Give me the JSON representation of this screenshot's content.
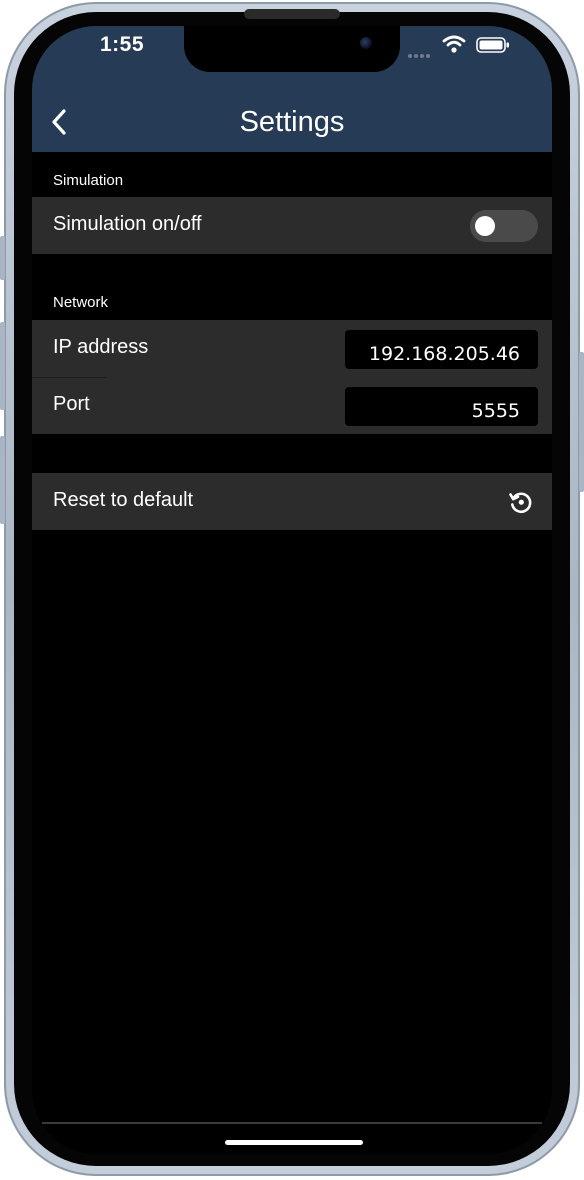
{
  "status_bar": {
    "time": "1:55",
    "icons": [
      "signal-dots-icon",
      "wifi-icon",
      "battery-icon"
    ]
  },
  "nav": {
    "title": "Settings",
    "back_icon": "chevron-left-icon",
    "background_color": "#263b55"
  },
  "sections": {
    "simulation": {
      "header": "Simulation",
      "toggle_label": "Simulation on/off",
      "toggle_on": false
    },
    "network": {
      "header": "Network",
      "ip_label": "IP address",
      "ip_value": "192.168.205.46",
      "port_label": "Port",
      "port_value": "5555"
    },
    "reset": {
      "label": "Reset to default",
      "icon": "reset-icon"
    }
  },
  "colors": {
    "row_background": "#2c2c2c",
    "screen_background": "#000000",
    "toggle_off": "#4a4a4a"
  }
}
